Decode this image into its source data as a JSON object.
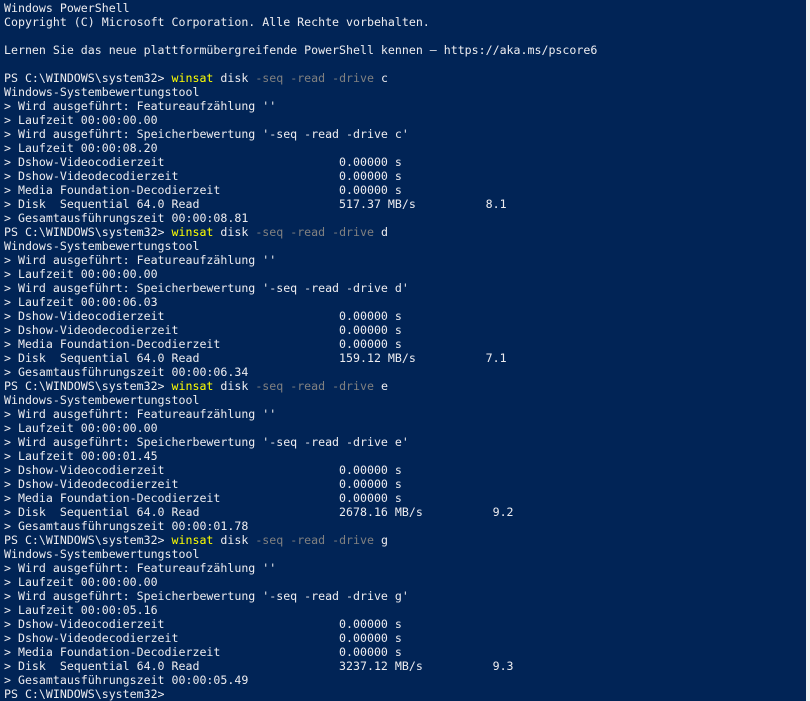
{
  "window": {
    "title": "Windows PowerShell"
  },
  "colors": {
    "background": "#012456",
    "foreground": "#eeedf0",
    "command": "#ffff00",
    "parameter": "#808080"
  },
  "console": {
    "header": [
      "Windows PowerShell",
      "Copyright (C) Microsoft Corporation. Alle Rechte vorbehalten.",
      "",
      "Lernen Sie das neue plattformübergreifende PowerShell kennen – https://aka.ms/pscore6",
      ""
    ],
    "runs": [
      {
        "prompt": "PS C:\\WINDOWS\\system32> ",
        "command": "winsat",
        "arg1": " disk ",
        "params": "-seq -read -drive",
        "drive": " c",
        "output": [
          "Windows-Systembewertungstool",
          "> Wird ausgeführt: Featureaufzählung ''",
          "> Laufzeit 00:00:00.00",
          "> Wird ausgeführt: Speicherbewertung '-seq -read -drive c'",
          "> Laufzeit 00:00:08.20",
          "> Dshow-Videocodierzeit                         0.00000 s",
          "> Dshow-Videodecodierzeit                       0.00000 s",
          "> Media Foundation-Decodierzeit                 0.00000 s",
          "> Disk  Sequential 64.0 Read                    517.37 MB/s          8.1",
          "> Gesamtausführungszeit 00:00:08.81"
        ]
      },
      {
        "prompt": "PS C:\\WINDOWS\\system32> ",
        "command": "winsat",
        "arg1": " disk ",
        "params": "-seq -read -drive",
        "drive": " d",
        "output": [
          "Windows-Systembewertungstool",
          "> Wird ausgeführt: Featureaufzählung ''",
          "> Laufzeit 00:00:00.00",
          "> Wird ausgeführt: Speicherbewertung '-seq -read -drive d'",
          "> Laufzeit 00:00:06.03",
          "> Dshow-Videocodierzeit                         0.00000 s",
          "> Dshow-Videodecodierzeit                       0.00000 s",
          "> Media Foundation-Decodierzeit                 0.00000 s",
          "> Disk  Sequential 64.0 Read                    159.12 MB/s          7.1",
          "> Gesamtausführungszeit 00:00:06.34"
        ]
      },
      {
        "prompt": "PS C:\\WINDOWS\\system32> ",
        "command": "winsat",
        "arg1": " disk ",
        "params": "-seq -read -drive",
        "drive": " e",
        "output": [
          "Windows-Systembewertungstool",
          "> Wird ausgeführt: Featureaufzählung ''",
          "> Laufzeit 00:00:00.00",
          "> Wird ausgeführt: Speicherbewertung '-seq -read -drive e'",
          "> Laufzeit 00:00:01.45",
          "> Dshow-Videocodierzeit                         0.00000 s",
          "> Dshow-Videodecodierzeit                       0.00000 s",
          "> Media Foundation-Decodierzeit                 0.00000 s",
          "> Disk  Sequential 64.0 Read                    2678.16 MB/s          9.2",
          "> Gesamtausführungszeit 00:00:01.78"
        ]
      },
      {
        "prompt": "PS C:\\WINDOWS\\system32> ",
        "command": "winsat",
        "arg1": " disk ",
        "params": "-seq -read -drive",
        "drive": " g",
        "output": [
          "Windows-Systembewertungstool",
          "> Wird ausgeführt: Featureaufzählung ''",
          "> Laufzeit 00:00:00.00",
          "> Wird ausgeführt: Speicherbewertung '-seq -read -drive g'",
          "> Laufzeit 00:00:05.16",
          "> Dshow-Videocodierzeit                         0.00000 s",
          "> Dshow-Videodecodierzeit                       0.00000 s",
          "> Media Foundation-Decodierzeit                 0.00000 s",
          "> Disk  Sequential 64.0 Read                    3237.12 MB/s          9.3",
          "> Gesamtausführungszeit 00:00:05.49"
        ]
      }
    ],
    "final_prompt": "PS C:\\WINDOWS\\system32>"
  }
}
